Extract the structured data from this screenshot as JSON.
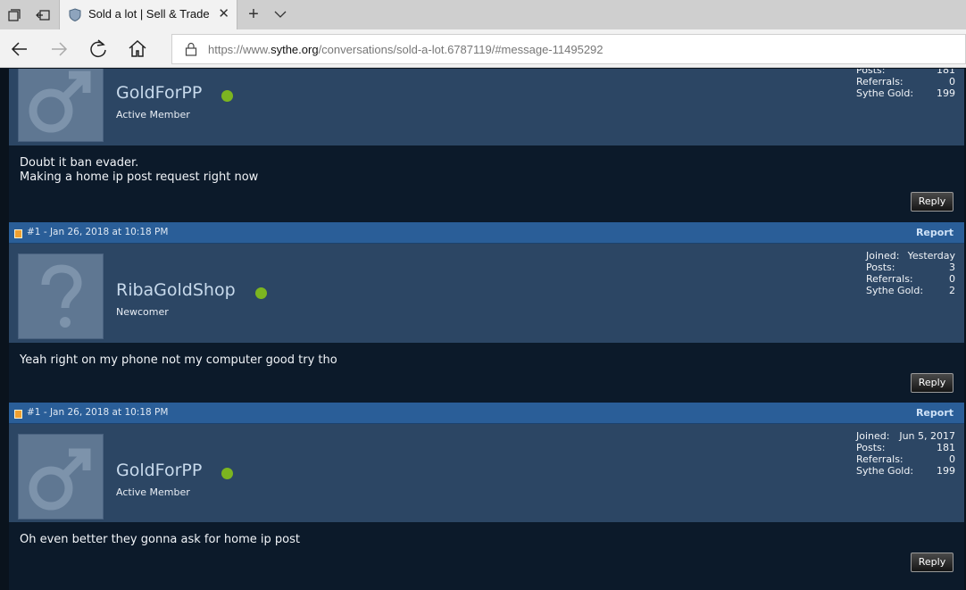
{
  "browser": {
    "tab_title": "Sold a lot | Sell & Trade",
    "url_prefix": "https://www.",
    "url_host": "sythe.org",
    "url_path": "/conversations/sold-a-lot.6787119/#message-11495292"
  },
  "posts": [
    {
      "username": "GoldForPP",
      "rank": "Active Member",
      "stats": [
        {
          "label": "Posts:",
          "value": "181"
        },
        {
          "label": "Referrals:",
          "value": "0"
        },
        {
          "label": "Sythe Gold:",
          "value": "199"
        }
      ],
      "message": [
        "Doubt it ban evader.",
        "Making a home ip post request right now"
      ],
      "reply_label": "Reply"
    },
    {
      "meta": "#1 - Jan 26, 2018 at 10:18 PM",
      "report_label": "Report",
      "username": "RibaGoldShop",
      "rank": "Newcomer",
      "stats": [
        {
          "label": "Joined:",
          "value": "Yesterday"
        },
        {
          "label": "Posts:",
          "value": "3"
        },
        {
          "label": "Referrals:",
          "value": "0"
        },
        {
          "label": "Sythe Gold:",
          "value": "2"
        }
      ],
      "message": [
        "Yeah right on my phone not my computer good try tho"
      ],
      "reply_label": "Reply"
    },
    {
      "meta": "#1 - Jan 26, 2018 at 10:18 PM",
      "report_label": "Report",
      "username": "GoldForPP",
      "rank": "Active Member",
      "stats": [
        {
          "label": "Joined:",
          "value": "Jun 5, 2017"
        },
        {
          "label": "Posts:",
          "value": "181"
        },
        {
          "label": "Referrals:",
          "value": "0"
        },
        {
          "label": "Sythe Gold:",
          "value": "199"
        }
      ],
      "message": [
        "Oh even better they gonna ask for home ip post"
      ],
      "reply_label": "Reply"
    }
  ],
  "colors": {
    "header_blue": "#2a5e98",
    "userbar": "#2c4664",
    "post_body": "#0c1a2a",
    "online_dot": "#7cb520"
  },
  "icons": [
    "tab-actions-icon",
    "set-aside-tabs-icon",
    "shield-favicon-icon",
    "close-icon",
    "new-tab-icon",
    "chevron-down-icon",
    "back-arrow-icon",
    "forward-arrow-icon",
    "refresh-icon",
    "home-icon",
    "lock-icon",
    "male-symbol-icon",
    "question-mark-icon",
    "post-icon"
  ]
}
